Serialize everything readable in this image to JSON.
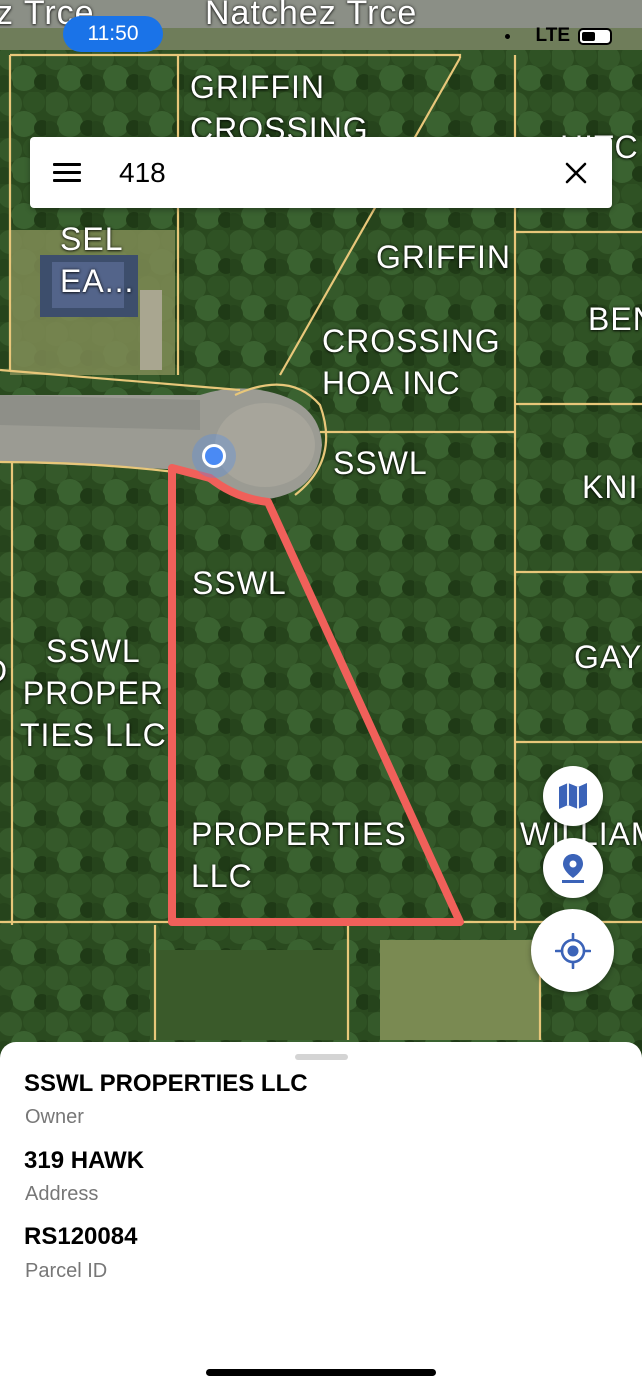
{
  "status_bar": {
    "time": "11:50",
    "network": "LTE"
  },
  "search": {
    "value": "418",
    "icons": {
      "menu": "hamburger-menu-icon",
      "clear": "close-icon"
    }
  },
  "map": {
    "road_labels": [
      "z Trce",
      "Natchez Trce"
    ],
    "parcel_labels": [
      "GRIFFIN\nCROSSING",
      "HITC",
      "SEL\nEA...",
      "GRIFFIN",
      "CROSSING\nHOA INC",
      "BEN",
      "SSWL",
      "KNI",
      "SSWL",
      "SSWL\nPROPER\nTIES LLC",
      "GAY",
      "D",
      "PROPERTIES\nLLC",
      "WILLIAM"
    ],
    "selected_outline_color": "#f0605a",
    "parcel_line_color": "#e8c77a",
    "location_dot_color": "#4a8af4"
  },
  "controls": {
    "layers_button_icon": "map-layers-icon",
    "pin_button_icon": "location-pin-icon",
    "locate_button_icon": "my-location-icon"
  },
  "sheet": {
    "owner_value": "SSWL PROPERTIES LLC",
    "owner_label": "Owner",
    "address_value": "319 HAWK",
    "address_label": "Address",
    "parcel_value": "RS120084",
    "parcel_label": "Parcel ID"
  },
  "colors": {
    "accent": "#1a73e8",
    "icon_blue": "#3b63b8"
  }
}
